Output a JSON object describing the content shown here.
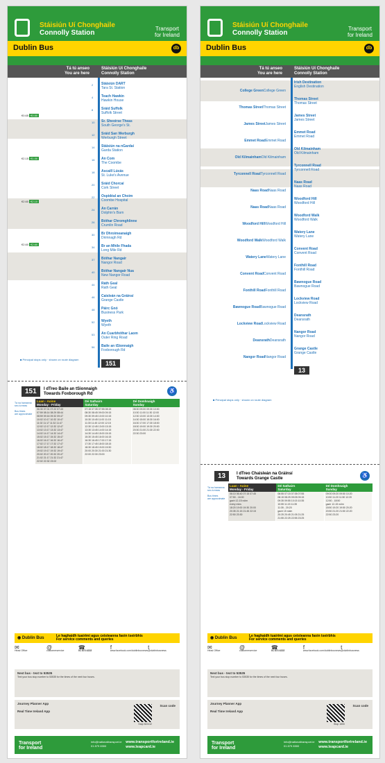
{
  "panel1": {
    "stop_ga": "Stáisiún Uí Chonghaile",
    "stop_en": "Connolly Station",
    "brand_top": "Transport",
    "brand_bot": "for Ireland",
    "operator": "Dublin Bus",
    "you_ga": "Tá tú anseo",
    "you_en": "You are here",
    "route": "151",
    "dest_ga": "I dTreo Baile an tSionnaigh",
    "dest_en": "Towards Foxborough Rd",
    "stops": [
      {
        "n": "2",
        "ga": "Stáisiún DART",
        "en": "Tara St. Station"
      },
      {
        "n": "4",
        "ga": "Teach Hawkin",
        "en": "Hawkin House"
      },
      {
        "n": "8",
        "ga": "Sráid Suffolk",
        "en": "Suffolk Street"
      },
      {
        "n": "10",
        "ga": "Sr. Sheoirse Theas",
        "en": "South George's St."
      },
      {
        "n": "12",
        "ga": "Sráid San Werburgh",
        "en": "Werburgh Street"
      },
      {
        "n": "14",
        "ga": "Stáisiún na nGardaí",
        "en": "Garda Station"
      },
      {
        "n": "16",
        "ga": "An Com",
        "en": "The Coombe"
      },
      {
        "n": "18",
        "ga": "Ascaill Lúcás",
        "en": "St. Luke's Avenue"
      },
      {
        "n": "20",
        "ga": "Sráid Chorcaí",
        "en": "Cork Street"
      },
      {
        "n": "22",
        "ga": "Ospidéal an Choim",
        "en": "Coombe Hospital"
      },
      {
        "n": "24",
        "ga": "An Carrán",
        "en": "Dolphin's Barn"
      },
      {
        "n": "26",
        "ga": "Bóthar Chromghlinne",
        "en": "Crumlin Road"
      },
      {
        "n": "30",
        "ga": "Br Dhroimeanaigh",
        "en": "Drimnagh Rd"
      },
      {
        "n": "34",
        "ga": "Br an Mhíle Fhada",
        "en": "Long Mile Rd"
      },
      {
        "n": "37",
        "ga": "Bóthar Nangair",
        "en": "Nangor Road"
      },
      {
        "n": "40",
        "ga": "Bóthar Nangair Nua",
        "en": "New Nangor Road"
      },
      {
        "n": "44",
        "ga": "Ráth Geal",
        "en": "Rath Geal"
      },
      {
        "n": "46",
        "ga": "Caisleán na Gráinsí",
        "en": "Grange Castle"
      },
      {
        "n": "48",
        "ga": "Páirc Gnó",
        "en": "Business Park"
      },
      {
        "n": "52",
        "ga": "Wyeth",
        "en": "Wyeth"
      },
      {
        "n": "53",
        "ga": "An Cuarbhóthar Laom",
        "en": "Outer Ring Road"
      },
      {
        "n": "56",
        "ga": "Baile an tSionnaigh",
        "en": "Foxborough Rd"
      }
    ],
    "fares": [
      {
        "a": "€0.65",
        "b": "€0.50"
      },
      {
        "a": "€2.15",
        "b": "€1.00"
      },
      {
        "a": "€2.60",
        "b": "€2.10"
      },
      {
        "a": "€2.60",
        "b": "€2.60"
      }
    ],
    "days": [
      "Luan - Aoine",
      "Monday - Friday",
      "Dé Sathairn",
      "Saturday",
      "Dé Domhnaigh",
      "Sunday"
    ],
    "wk": "06:30 07:01 07:22 07:43\n07:59 08:14 08:29 08:44\n08:59 09:16 09:32 09:47\n10:02 10:17 10:32 10:47\n11:02 11:17 11:32 11:47\n12:02 12:17 12:32 12:47\n13:02 13:17 13:32 13:47\n14:02 14:17 14:32 14:47\n15:02 15:17 15:32 15:47\n16:02 16:17 16:32 16:47\n17:02 17:17 17:32 17:47\n18:02 18:17 18:32 18:47\n19:02 19:17 19:32 19:47\n20:02 20:17 20:32 20:47\n21:02 21:17 21:32 21:47\n22:02 22:32 23:02",
    "sa": "07:15 07:35 07:55 08:15\n08:30 08:45 09:00 09:15\n09:30 09:45 10:00 10:15\n10:30 10:45 11:00 11:15\n11:30 11:45 12:00 12:15\n12:30 12:45 13:00 13:15\n13:30 13:45 14:00 14:15\n14:30 14:45 15:00 15:15\n15:30 15:45 16:00 16:15\n16:30 16:45 17:00 17:15\n17:30 17:45 18:00 18:15\n18:30 18:45 19:00 19:30\n20:00 20:30 21:00 21:30\n22:00 22:30 23:00",
    "su": "08:30 09:00 09:30 10:00\n10:30 11:00 11:30 12:00\n12:30 13:00 13:30 14:00\n14:30 15:00 15:30 16:00\n16:30 17:00 17:30 18:00\n18:30 19:00 19:30 20:00\n20:30 21:00 21:30 22:00\n22:30 23:00"
  },
  "panel2": {
    "stop_ga": "Stáisiún Uí Chonghaile",
    "stop_en": "Connolly Station",
    "operator": "Dublin Bus",
    "you_ga": "Tá tú anseo",
    "you_en": "You are here",
    "route": "13",
    "dest_ga": "I dTreo Chaisleán na Gráinsí",
    "dest_en": "Towards Grange Castle",
    "left": [
      [
        "College Green",
        "College Green"
      ],
      [
        "Thomas Street",
        "Thomas Street"
      ],
      [
        "James Street",
        "James Street"
      ],
      [
        "Emmet Road",
        "Emmet Road"
      ],
      [
        "Old Kilmainham",
        "Old Kilmainham"
      ],
      [
        "Tyrconnell Road",
        "Tyrconnell Road"
      ],
      [
        "Naas Road",
        "Naas Road"
      ],
      [
        "Naas Road",
        "Naas Road"
      ],
      [
        "Woodford Hill",
        "Woodford Hill"
      ],
      [
        "Woodford Walk",
        "Woodford Walk"
      ],
      [
        "Watery Lane",
        "Watery Lane"
      ],
      [
        "Convent Road",
        "Convent Road"
      ],
      [
        "Fonthill Road",
        "Fonthill Road"
      ],
      [
        "Bawnogue Road",
        "Bawnogue Road"
      ],
      [
        "Lockview Road",
        "Lockview Road"
      ],
      [
        "Deansrath",
        "Deansrath"
      ],
      [
        "Nangor Road",
        "Nangor Road"
      ]
    ],
    "right": [
      [
        "Irish Destination",
        "English Destination"
      ],
      [
        "Thomas Street",
        "Thomas Street"
      ],
      [
        "James Street",
        "James Street"
      ],
      [
        "Emmet Road",
        "Emmet Road"
      ],
      [
        "Old Kilmainham",
        "Old Kilmainham"
      ],
      [
        "Tyrconnell Road",
        "Tyrconnell Road"
      ],
      [
        "Naas Road",
        "Naas Road"
      ],
      [
        "Woodford Hill",
        "Woodford Hill"
      ],
      [
        "Woodford Walk",
        "Woodford Walk"
      ],
      [
        "Watery Lane",
        "Watery Lane"
      ],
      [
        "Convent Road",
        "Convent Road"
      ],
      [
        "Fonthill Road",
        "Fonthill Road"
      ],
      [
        "Bawnogue Road",
        "Bawnogue Road"
      ],
      [
        "Lockview Road",
        "Lockview Road"
      ],
      [
        "Deansrath",
        "Deansrath"
      ],
      [
        "Nangor Road",
        "Nangor Road"
      ],
      [
        "Grange Castle",
        "Grange Castle"
      ]
    ],
    "wk": "06:10 06:40 07:15 07:45\n07:50 - 16:00\ngach 12-15 nóim\nevery mins\n18:20 19:00 19:30 20:00\n20:35 21:15 21:45 22:15\n22:50 23:30",
    "sa": "06:55 07:15 07:35 07:55\n08:15 08:25 09:05 09:15\n09:35 09:55 10:15 10:35\n10:55 11:15 11:35\n11:35 - 20:20\ngach 15 nóim\n20:25 20:45 21:05 21:25\n21:55 22:25 22:55 23:25",
    "su": "09:00 09:20 09:50 10:20\n10:50 11:20 11:50 12:20\n12:50 - 18:50\ngach 12-15 nóim\n18:50 19:20 19:50 20:20\n20:50 21:20 21:50 22:20\n22:50 23:20"
  },
  "footer": {
    "title_ga": "Le haghaidh tuairimí agus ceisteanna faoin tseirbhís",
    "title_en": "For service comments and queries",
    "phone": "01 873 4222",
    "twitter": "@dublinbusnews",
    "fb": "www.facebook.com/dublinbusnews",
    "next_bus": "Next bus - text to 53535",
    "journey": "Journey Planner App",
    "realtime": "Real Time Ireland App",
    "scan": "Scan code",
    "stop1": "Stop 522112",
    "stop2": "Stop 1500",
    "email": "info@nationaltransport.ie",
    "phone2": "01 879 8300",
    "w1": "www.transportforireland.ie",
    "w2": "www.leapcard.ie"
  }
}
